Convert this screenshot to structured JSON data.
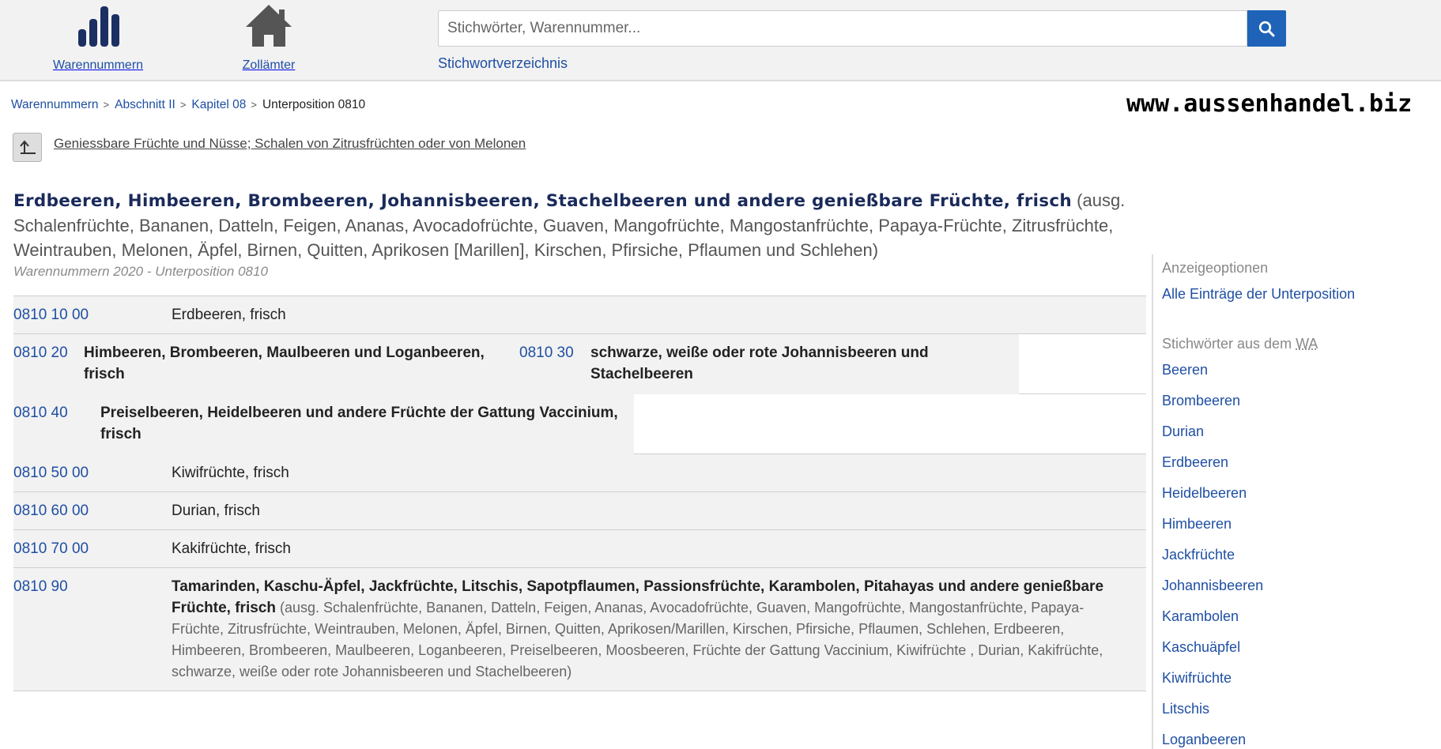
{
  "nav": {
    "warennummern_label": "Warennummern",
    "zollaemter_label": "Zollämter",
    "warennummern_icon": "bar-chart-icon",
    "zollaemter_icon": "house-icon"
  },
  "search": {
    "placeholder": "Stichwörter, Warennummer...",
    "value": "",
    "button_icon": "search-icon",
    "keyword_link": "Stichwortverzeichnis"
  },
  "breadcrumb": {
    "items": [
      "Warennummern",
      "Abschnitt II",
      "Kapitel 08"
    ],
    "current": "Unterposition 0810",
    "separator": ">"
  },
  "watermark": "www.aussenhandel.biz",
  "parent": {
    "icon": "level-up-icon",
    "label": "Geniessbare Früchte und Nüsse; Schalen von Zitrusfrüchten oder von Melonen"
  },
  "heading": {
    "main": "Erdbeeren, Himbeeren, Brombeeren, Johannisbeeren, Stachelbeeren und andere genießbare Früchte, frisch",
    "rest": " (ausg. Schalenfrüchte, Bananen, Datteln, Feigen, Ananas, Avocadofrüchte, Guaven, Mangofrüchte, Mangostanfrüchte, Papaya-Früchte, Zitrusfrüchte, Weintrauben, Melonen, Äpfel, Birnen, Quitten, Aprikosen [Marillen], Kirschen, Pfirsiche, Pflaumen und Schlehen)",
    "subline": "Warennummern 2020 - Unterposition 0810"
  },
  "rows": [
    {
      "code": "0810 10 00",
      "desc": "Erdbeeren, frisch"
    },
    {
      "code": "0810 20",
      "desc": "Himbeeren, Brombeeren, Maulbeeren und Loganbeeren, frisch"
    },
    {
      "code": "0810 30",
      "desc": "schwarze, weiße oder rote Johannisbeeren und Stachelbeeren"
    },
    {
      "code": "0810 40",
      "desc": "Preiselbeeren, Heidelbeeren und andere Früchte der Gattung Vaccinium, frisch"
    },
    {
      "code": "0810 50 00",
      "desc": "Kiwifrüchte, frisch"
    },
    {
      "code": "0810 60 00",
      "desc": "Durian, frisch"
    },
    {
      "code": "0810 70 00",
      "desc": "Kakifrüchte, frisch"
    },
    {
      "code": "0810 90",
      "desc": "Tamarinden, Kaschu-Äpfel, Jackfrüchte, Litschis, Sapotpflaumen, Passionsfrüchte, Karambolen, Pitahayas und andere genießbare Früchte, frisch",
      "note": " (ausg. Schalenfrüchte, Bananen, Datteln, Feigen, Ananas, Avocadofrüchte, Guaven, Mangofrüchte, Mangostanfrüchte, Papaya-Früchte, Zitrusfrüchte, Weintrauben, Melonen, Äpfel, Birnen, Quitten, Aprikosen/Marillen, Kirschen, Pfirsiche, Pflaumen, Schlehen, Erdbeeren, Himbeeren, Brombeeren, Maulbeeren, Loganbeeren, Preiselbeeren, Moosbeeren, Früchte der Gattung Vaccinium, Kiwifrüchte , Durian, Kakifrüchte, schwarze, weiße oder rote Johannisbeeren und Stachelbeeren)"
    }
  ],
  "sidebar": {
    "display_heading": "Anzeigeoptionen",
    "display_link": "Alle Einträge der Unterposition",
    "keywords_heading_prefix": "Stichwörter aus dem ",
    "keywords_heading_abbr": "WA",
    "keywords": [
      "Beeren",
      "Brombeeren",
      "Durian",
      "Erdbeeren",
      "Heidelbeeren",
      "Himbeeren",
      "Jackfrüchte",
      "Johannisbeeren",
      "Karambolen",
      "Kaschuäpfel",
      "Kiwifrüchte",
      "Litschis",
      "Loganbeeren"
    ]
  },
  "colors": {
    "link": "#1f4fa3",
    "search_button": "#1e63b7",
    "row_bg": "#f2f2f2",
    "nav_icon": "#1b2f63",
    "house_icon": "#555555"
  }
}
